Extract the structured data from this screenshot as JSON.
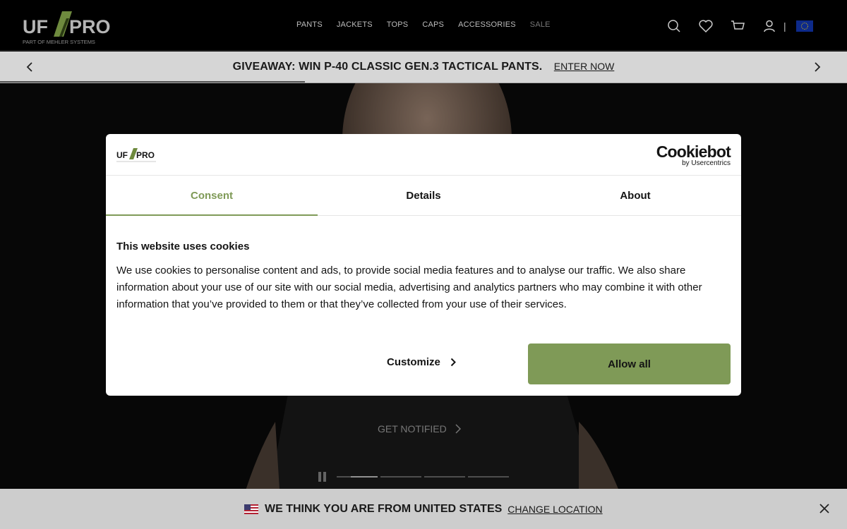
{
  "header": {
    "logo_text": "UFPRO",
    "logo_tagline": "PART OF MEHLER SYSTEMS",
    "nav": [
      {
        "label": "PANTS"
      },
      {
        "label": "JACKETS"
      },
      {
        "label": "TOPS"
      },
      {
        "label": "CAPS"
      },
      {
        "label": "ACCESSORIES"
      },
      {
        "label": "SALE"
      }
    ],
    "icons": [
      "search-icon",
      "heart-icon",
      "cart-icon",
      "user-icon",
      "eu-flag-icon"
    ],
    "separator": "|"
  },
  "promo": {
    "title": "GIVEAWAY: WIN P-40 CLASSIC GEN.3 TACTICAL PANTS.",
    "link": "ENTER NOW",
    "progress": 0.36
  },
  "hero": {
    "cta": "GET NOTIFIED",
    "slides_total": 4,
    "active_slide": 1
  },
  "cookie_modal": {
    "logo_text": "UFPRO",
    "brand": "Cookiebot",
    "brand_sub": "by Usercentrics",
    "tabs": [
      {
        "label": "Consent",
        "active": true
      },
      {
        "label": "Details",
        "active": false
      },
      {
        "label": "About",
        "active": false
      }
    ],
    "title": "This website uses cookies",
    "text": "We use cookies to personalise content and ads, to provide social media features and to analyse our traffic. We also share information about your use of our site with our social media, advertising and analytics partners who may combine it with other information that you’ve provided to them or that they’ve collected from your use of their services.",
    "customize_label": "Customize",
    "allow_label": "Allow all",
    "accent_color": "#7f9a57"
  },
  "location_bar": {
    "text": "WE THINK YOU ARE FROM UNITED STATES",
    "link": "CHANGE LOCATION"
  }
}
